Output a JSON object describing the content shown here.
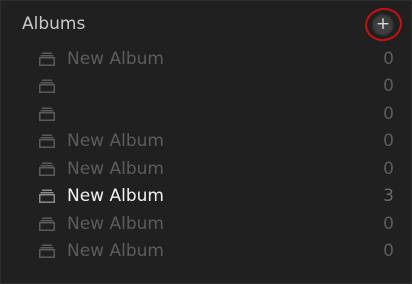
{
  "albums": {
    "title": "Albums",
    "add_button_glyph": "+",
    "add_icon": "plus-icon",
    "album_icon": "album-stack-icon",
    "highlight_color": "#c80f12",
    "items": [
      {
        "name": "New Album",
        "count": "0",
        "active": false
      },
      {
        "name": "",
        "count": "0",
        "active": false
      },
      {
        "name": "",
        "count": "0",
        "active": false
      },
      {
        "name": "New Album",
        "count": "0",
        "active": false
      },
      {
        "name": "New Album",
        "count": "0",
        "active": false
      },
      {
        "name": "New Album",
        "count": "3",
        "active": true
      },
      {
        "name": "New Album",
        "count": "0",
        "active": false
      },
      {
        "name": "New Album",
        "count": "0",
        "active": false
      }
    ]
  }
}
